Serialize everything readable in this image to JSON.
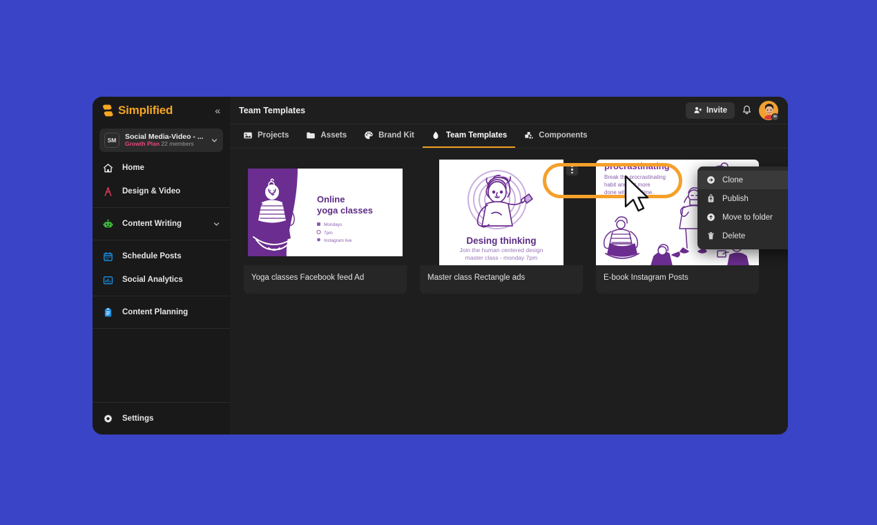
{
  "theme": {
    "desktop_bg": "#3a44c6",
    "window_bg": "#1e1e1e",
    "sidebar_bg": "#191919",
    "brand_color": "#f5a623",
    "accent_orange": "#f0a020",
    "annotation_color": "#f5a02a",
    "plan_color": "#e9457f",
    "card_bg": "#262626",
    "menu_bg": "#2b2b2b",
    "artwork_purple": "#6b2d8f"
  },
  "sidebar": {
    "brand": {
      "name": "Simplified",
      "logo_icon": "simplified-logo-icon"
    },
    "collapse_icon": "«",
    "workspace": {
      "initials": "SM",
      "title": "Social Media-Video - ...",
      "plan": "Growth Plan",
      "members": "22 members",
      "chevron_icon": "chevron-down-icon"
    },
    "groups": [
      {
        "items": [
          {
            "label": "Home",
            "icon": "home-icon",
            "expandable": false
          },
          {
            "label": "Design & Video",
            "icon": "design-video-icon",
            "expandable": false
          }
        ]
      },
      {
        "items": [
          {
            "label": "Content Writing",
            "icon": "robot-icon",
            "expandable": true
          }
        ]
      },
      {
        "items": [
          {
            "label": "Schedule Posts",
            "icon": "calendar-icon",
            "expandable": false
          },
          {
            "label": "Social Analytics",
            "icon": "bar-chart-icon",
            "expandable": false
          }
        ]
      },
      {
        "items": [
          {
            "label": "Content Planning",
            "icon": "clipboard-icon",
            "expandable": false
          }
        ]
      }
    ],
    "footer": {
      "label": "Settings",
      "icon": "gear-icon"
    }
  },
  "header": {
    "page_title": "Team Templates",
    "invite_label": "Invite",
    "invite_icon": "user-plus-icon",
    "bell_icon": "bell-icon",
    "avatar_icon": "avatar",
    "avatar_badge": "w"
  },
  "tabs": [
    {
      "label": "Projects",
      "icon": "image-icon",
      "active": false
    },
    {
      "label": "Assets",
      "icon": "folder-icon",
      "active": false
    },
    {
      "label": "Brand Kit",
      "icon": "palette-icon",
      "active": false
    },
    {
      "label": "Team Templates",
      "icon": "drop-icon",
      "active": true
    },
    {
      "label": "Components",
      "icon": "components-icon",
      "active": false
    }
  ],
  "cards": [
    {
      "name": "Yoga classes Facebook feed Ad",
      "art": "yoga",
      "art_text": {
        "title_line1": "Online",
        "title_line2": "yoga classes",
        "bullets": [
          "Mondays",
          "7pm",
          "Instagram live"
        ]
      }
    },
    {
      "name": "Master class Rectangle ads",
      "art": "design-thinking",
      "art_text": {
        "title_line1": "Desing thinking",
        "subtitle_line1": "Join the human centered design",
        "subtitle_line2": "master class - monday 7pm"
      },
      "has_kebab": true
    },
    {
      "name": "E-book Instagram Posts",
      "art": "ebook",
      "art_text": {
        "title_line1": "procrastinating",
        "body_line1": "Break the procrastinating",
        "body_line2": "habit and get more",
        "body_line3": "done with your time."
      }
    }
  ],
  "context_menu": {
    "items": [
      {
        "label": "Clone",
        "icon": "clone-arrow-icon",
        "highlighted": true
      },
      {
        "label": "Publish",
        "icon": "publish-icon",
        "highlighted": false
      },
      {
        "label": "Move to folder",
        "icon": "move-folder-icon",
        "highlighted": false
      },
      {
        "label": "Delete",
        "icon": "trash-icon",
        "highlighted": false
      }
    ]
  },
  "annotation": {
    "shape": "rounded-rect-outline",
    "targets": "Clone"
  },
  "cursor": {
    "type": "arrow-pointer"
  }
}
